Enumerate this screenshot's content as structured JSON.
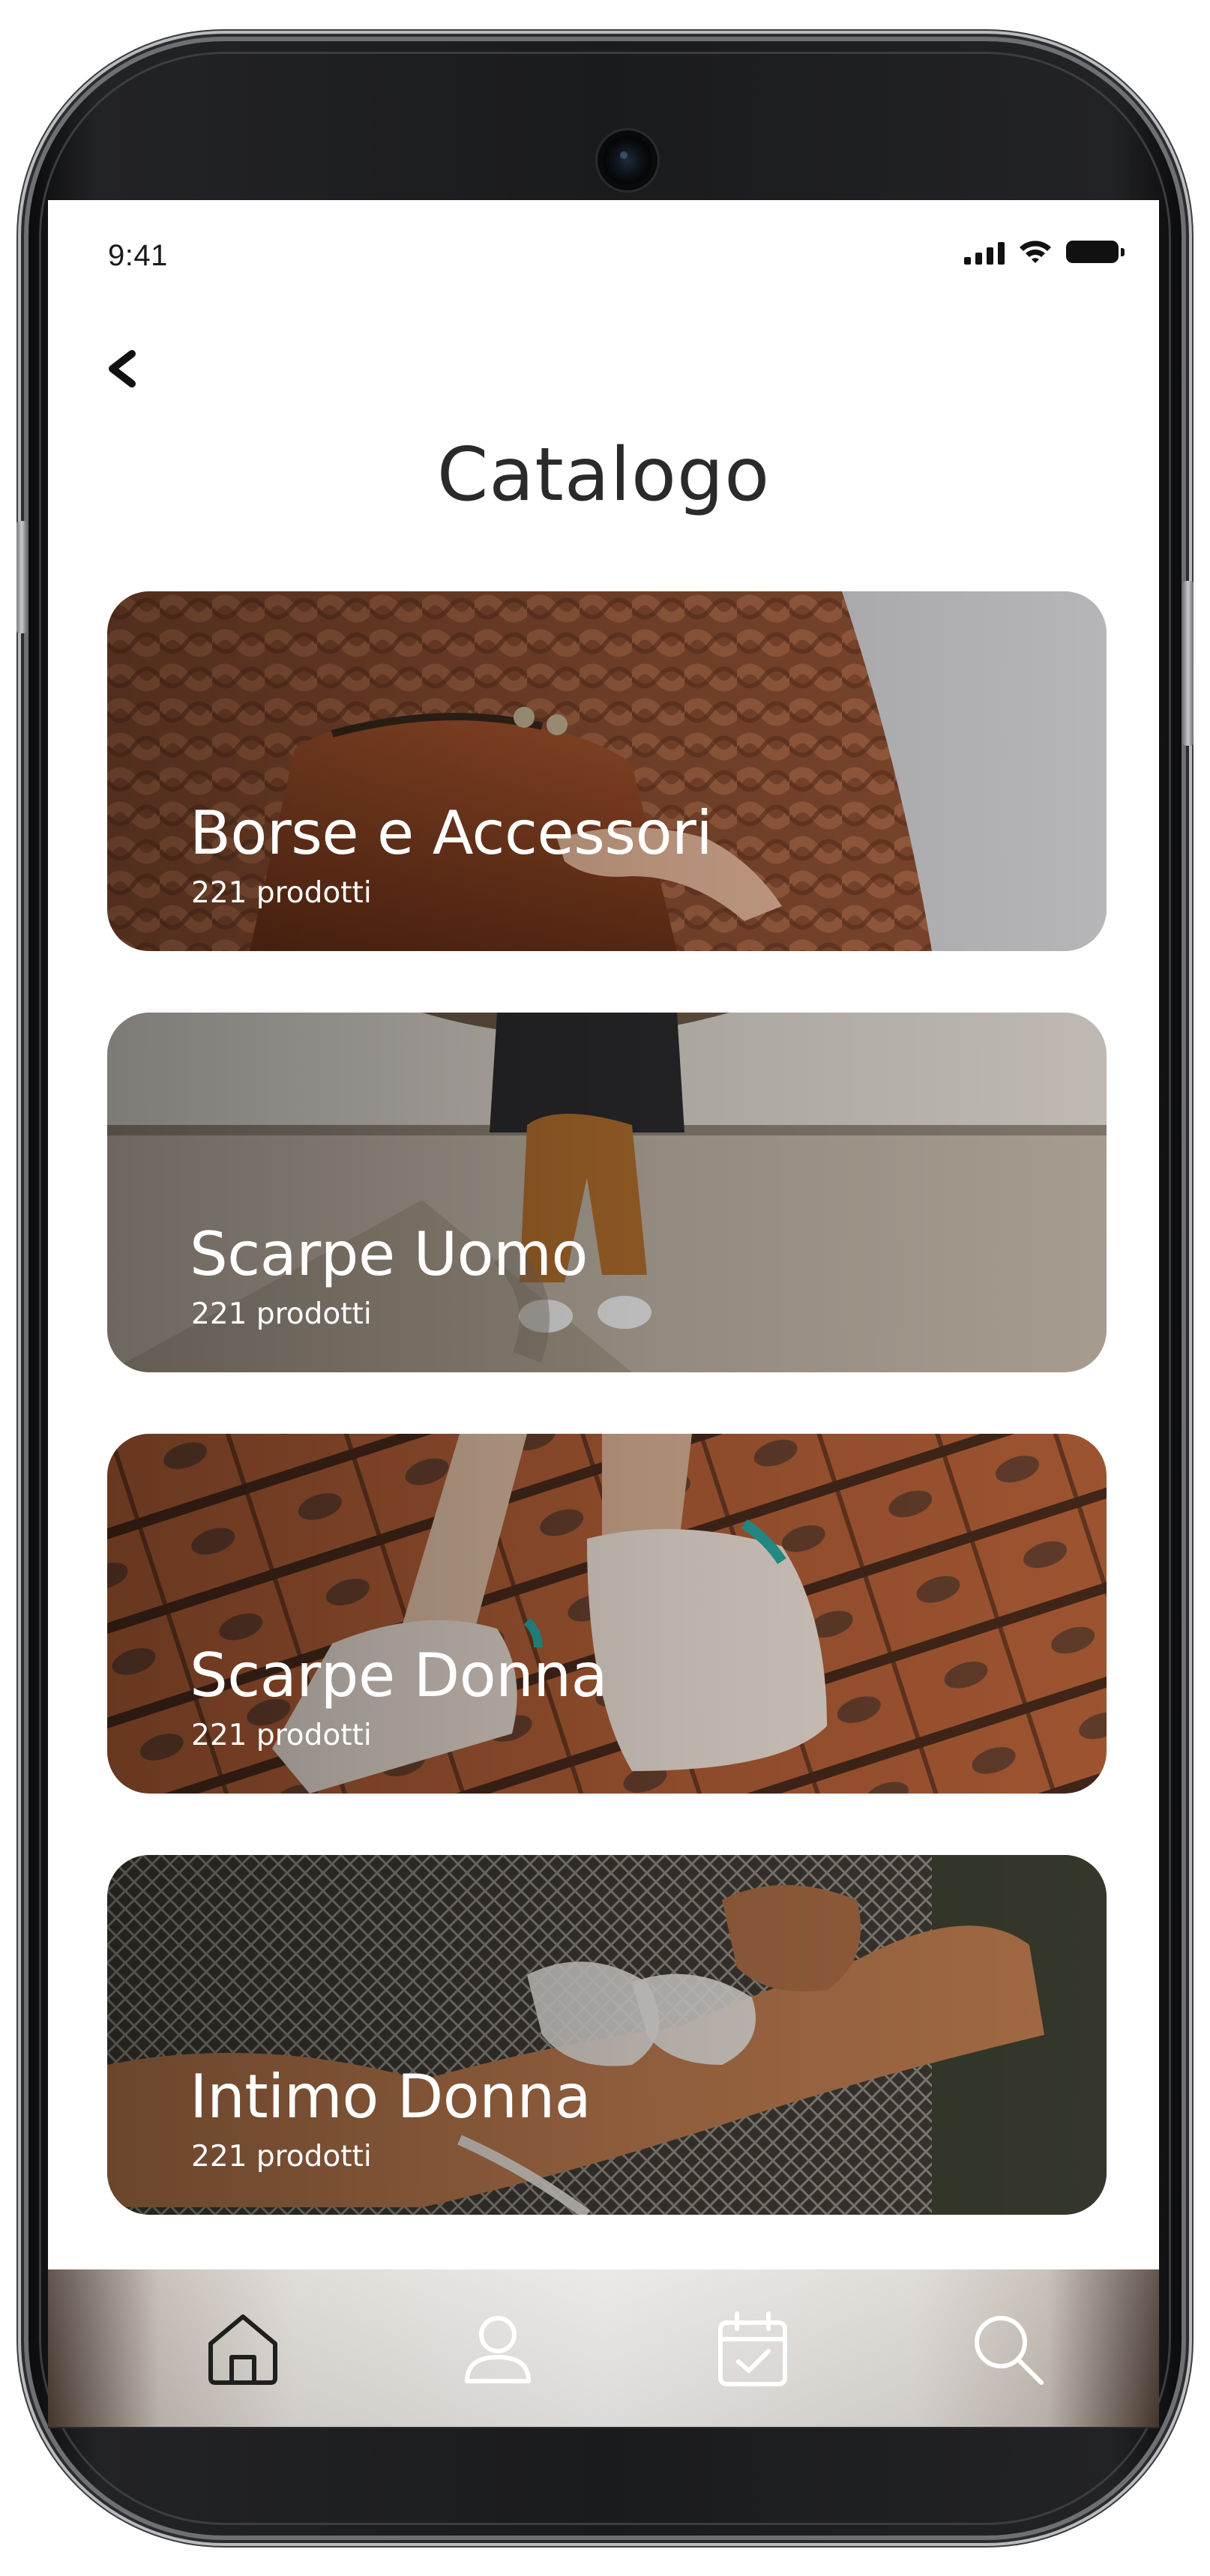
{
  "status_bar": {
    "time": "9:41"
  },
  "header": {
    "back_icon": "chevron-left-icon",
    "title": "Catalogo"
  },
  "categories": [
    {
      "title": "Borse e Accessori",
      "count": "221 prodotti"
    },
    {
      "title": "Scarpe Uomo",
      "count": "221 prodotti"
    },
    {
      "title": "Scarpe Donna",
      "count": "221 prodotti"
    },
    {
      "title": "Intimo Donna",
      "count": "221 prodotti"
    }
  ],
  "bottom_nav": {
    "items": [
      {
        "icon": "home-icon",
        "active": true
      },
      {
        "icon": "user-icon",
        "active": false
      },
      {
        "icon": "calendar-check-icon",
        "active": false
      },
      {
        "icon": "search-icon",
        "active": false
      }
    ]
  },
  "colors": {
    "title_text": "#2a2a2a",
    "card_text": "#ffffff",
    "nav_active": "#1f1f1f",
    "nav_inactive": "#ffffff"
  }
}
